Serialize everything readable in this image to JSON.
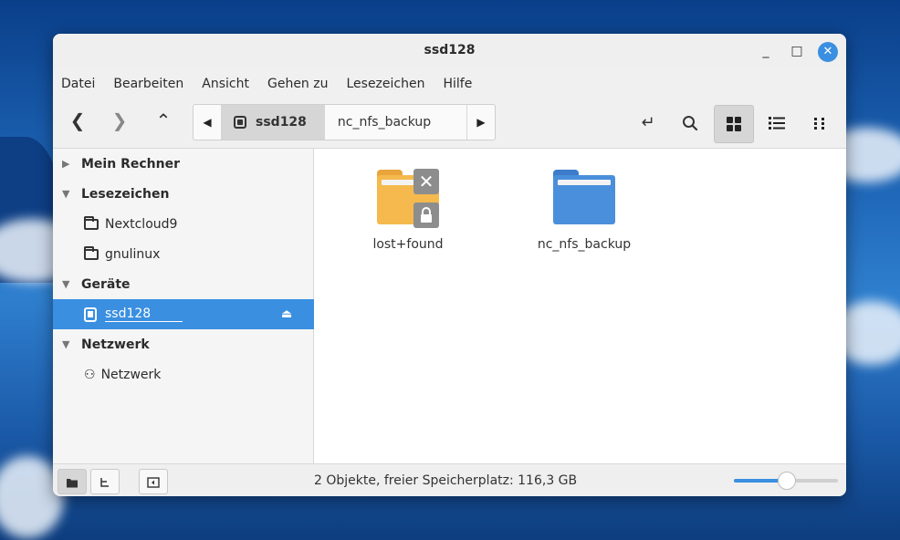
{
  "window": {
    "title": "ssd128",
    "minimize": "_",
    "maximize": "□",
    "close": "✕"
  },
  "menu": [
    "Datei",
    "Bearbeiten",
    "Ansicht",
    "Gehen zu",
    "Lesezeichen",
    "Hilfe"
  ],
  "toolbar": {
    "back": "❮",
    "forward": "❯",
    "up": "⌃",
    "path_left": "◀",
    "path_right": "▶",
    "breadcrumbs": [
      {
        "label": "ssd128",
        "active": true
      },
      {
        "label": "nc_nfs_backup",
        "active": false
      }
    ],
    "toggle_location": "↵",
    "search": "⌕",
    "view_icons": "▦",
    "view_list": "☰",
    "view_compact": "⁝⁝"
  },
  "sidebar": {
    "sections": [
      {
        "label": "Mein Rechner",
        "expanded": false,
        "items": []
      },
      {
        "label": "Lesezeichen",
        "expanded": true,
        "items": [
          {
            "label": "Nextcloud9"
          },
          {
            "label": "gnulinux"
          }
        ]
      },
      {
        "label": "Geräte",
        "expanded": true,
        "items": [
          {
            "label": "ssd128",
            "selected": true
          }
        ]
      },
      {
        "label": "Netzwerk",
        "expanded": true,
        "items": [
          {
            "label": "Netzwerk"
          }
        ]
      }
    ]
  },
  "files": [
    {
      "name": "lost+found",
      "color": "#f5b94e",
      "locked": true
    },
    {
      "name": "nc_nfs_backup",
      "color": "#4a8fdb",
      "locked": false
    }
  ],
  "status": {
    "text": "2 Objekte, freier Speicherplatz: 116,3 GB",
    "zoom_fraction": 0.5
  },
  "colors": {
    "accent": "#3a8fe0"
  }
}
